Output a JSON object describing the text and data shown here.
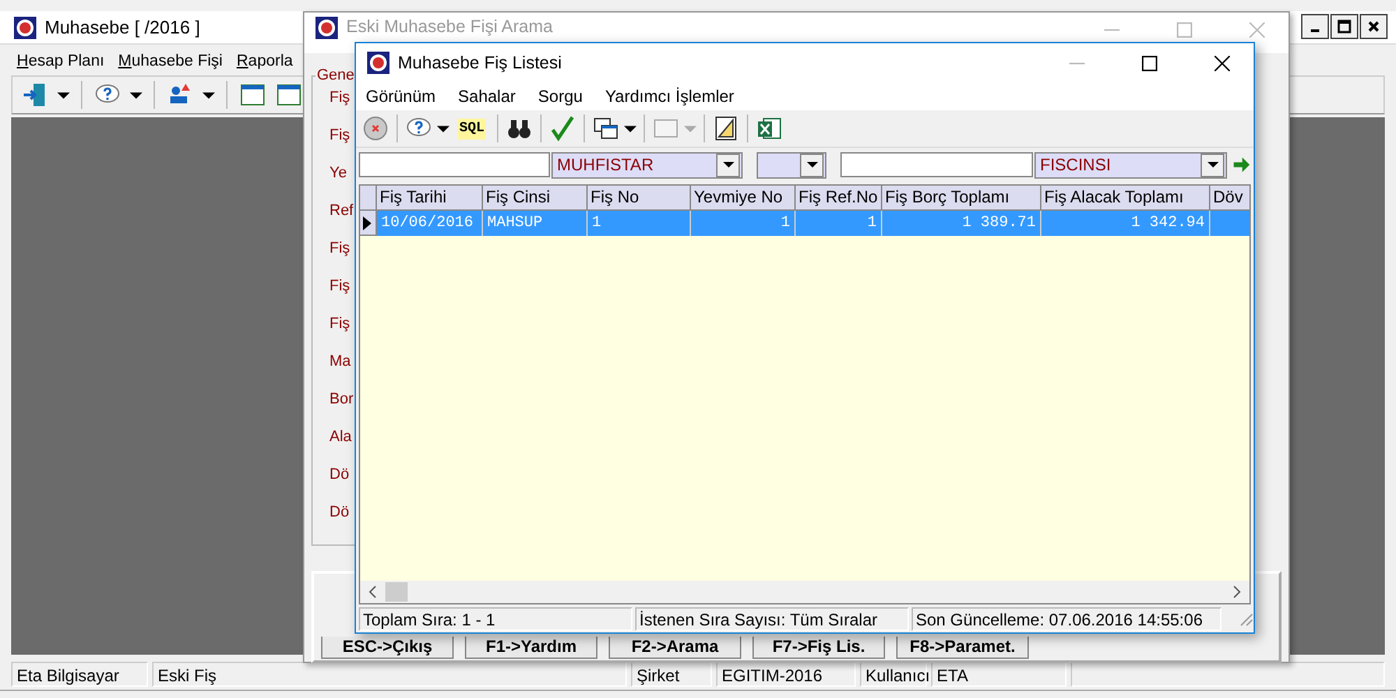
{
  "main_window": {
    "title": "Muhasebe [ /2016 ]",
    "menu": [
      "Hesap Planı",
      "Muhasebe Fişi",
      "Raporla"
    ],
    "status_bar": [
      "Eta Bilgisayar",
      "Eski Fiş",
      "Şirket",
      "EGITIM-2016",
      "Kullanıcı",
      "ETA"
    ]
  },
  "search_window": {
    "title": "Eski Muhasebe Fişi Arama",
    "active": false,
    "group_title": "Gene",
    "labels": [
      "Fiş",
      "Fiş",
      "Ye",
      "Ref",
      "Fiş",
      "Fiş",
      "Fiş",
      "Ma",
      "Bor",
      "Ala",
      "Dö",
      "Dö"
    ],
    "buttons": [
      "ESC->Çıkış",
      "F1->Yardım",
      "F2->Arama",
      "F7->Fiş Lis.",
      "F8->Paramet."
    ]
  },
  "list_window": {
    "title": "Muhasebe Fiş Listesi",
    "active": true,
    "menu": [
      "Görünüm",
      "Sahalar",
      "Sorgu",
      "Yardımcı İşlemler"
    ],
    "sql_button": "SQL",
    "filters": [
      {
        "kind": "input"
      },
      {
        "kind": "combo",
        "value": "MUHFISTAR"
      },
      {
        "kind": "combo"
      },
      {
        "kind": "input"
      },
      {
        "kind": "combo",
        "value": "FISCINSI"
      }
    ],
    "table": {
      "columns": [
        "Fiş Tarihi",
        "Fiş Cinsi",
        "Fiş No",
        "Yevmiye No",
        "Fiş Ref.No",
        "Fiş Borç Toplamı",
        "Fiş Alacak Toplamı",
        "Döv"
      ],
      "rows": [
        {
          "selected": true,
          "cells": [
            "10/06/2016",
            "MAHSUP",
            "1",
            "1",
            "1",
            "1 389.71",
            "1 342.94",
            ""
          ]
        }
      ]
    },
    "status_bar": [
      "Toplam Sıra: 1 - 1",
      "İstenen Sıra Sayısı: Tüm Sıralar",
      "Son Güncelleme: 07.06.2016 14:55:06"
    ]
  }
}
